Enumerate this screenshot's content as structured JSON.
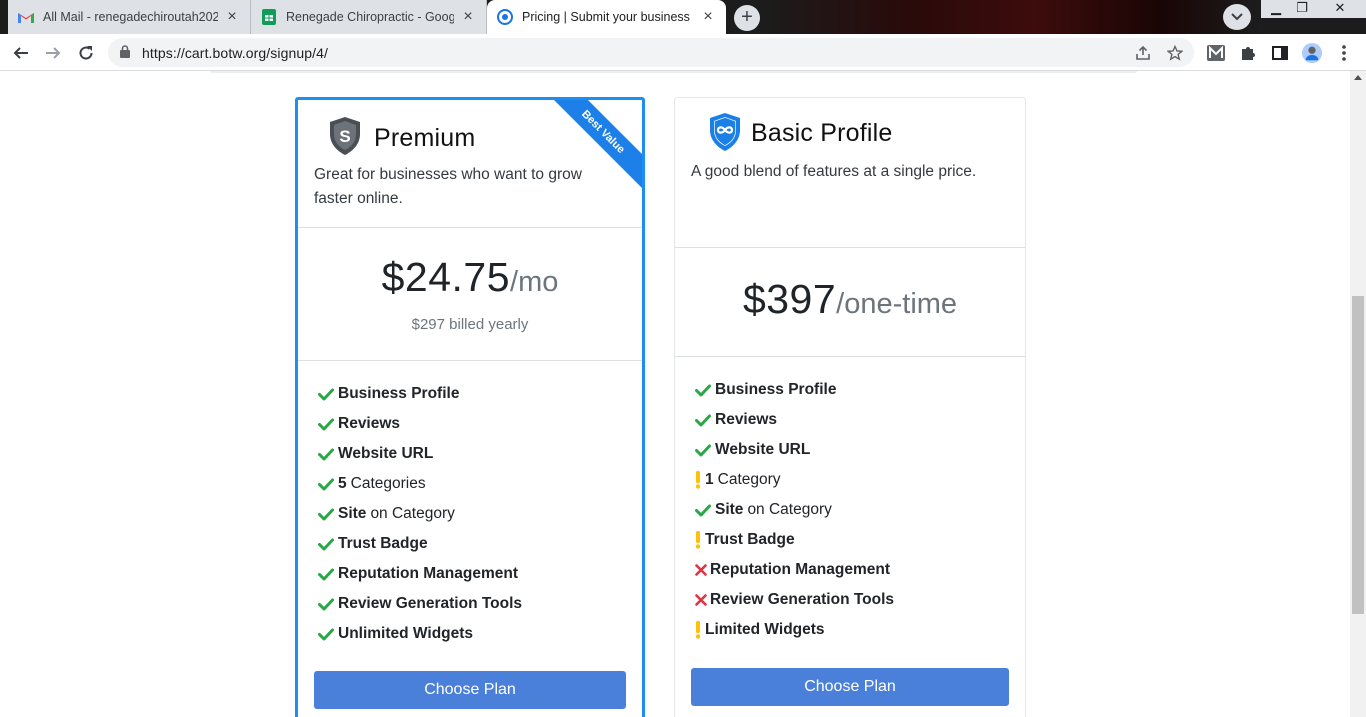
{
  "browser": {
    "tabs": [
      {
        "title": "All Mail - renegadechiroutah2023",
        "favicon": "gmail-icon",
        "active": false
      },
      {
        "title": "Renegade Chiropractic - Google",
        "favicon": "sheets-icon",
        "active": false
      },
      {
        "title": "Pricing | Submit your business",
        "favicon": "botw-icon",
        "active": true
      }
    ],
    "url": "https://cart.botw.org/signup/4/"
  },
  "plans": {
    "premium": {
      "name": "Premium",
      "icon": "shield-s-icon",
      "ribbon": "Best Value",
      "description": "Great for businesses who want to grow faster online.",
      "price": "$24.75",
      "period": "/mo",
      "billed": "$297 billed yearly",
      "features": [
        {
          "status": "check",
          "label": "Business Profile"
        },
        {
          "status": "check",
          "label": "Reviews"
        },
        {
          "status": "check",
          "label": "Website URL"
        },
        {
          "status": "check",
          "prefix": "5",
          "label": "Categories"
        },
        {
          "status": "check",
          "prefix": "Site",
          "label": "on Category"
        },
        {
          "status": "check",
          "label": "Trust Badge"
        },
        {
          "status": "check",
          "label": "Reputation Management"
        },
        {
          "status": "check",
          "label": "Review Generation Tools"
        },
        {
          "status": "check",
          "label": "Unlimited Widgets"
        }
      ],
      "button": "Choose Plan"
    },
    "basic": {
      "name": "Basic Profile",
      "icon": "shield-infinity-icon",
      "description": "A good blend of features at a single price.",
      "price": "$397",
      "period": "/one-time",
      "features": [
        {
          "status": "check",
          "label": "Business Profile"
        },
        {
          "status": "check",
          "label": "Reviews"
        },
        {
          "status": "check",
          "label": "Website URL"
        },
        {
          "status": "warn",
          "prefix": "1",
          "label": "Category"
        },
        {
          "status": "check",
          "prefix": "Site",
          "label": "on Category"
        },
        {
          "status": "warn",
          "label": "Trust Badge"
        },
        {
          "status": "cross",
          "label": "Reputation Management"
        },
        {
          "status": "cross",
          "label": "Review Generation Tools"
        },
        {
          "status": "warn",
          "label": "Limited Widgets"
        }
      ],
      "button": "Choose Plan"
    }
  },
  "colors": {
    "accent": "#1d8ff2",
    "button": "#4a80d9",
    "check": "#28a745",
    "warn": "#ffc107",
    "cross": "#dc3545"
  }
}
